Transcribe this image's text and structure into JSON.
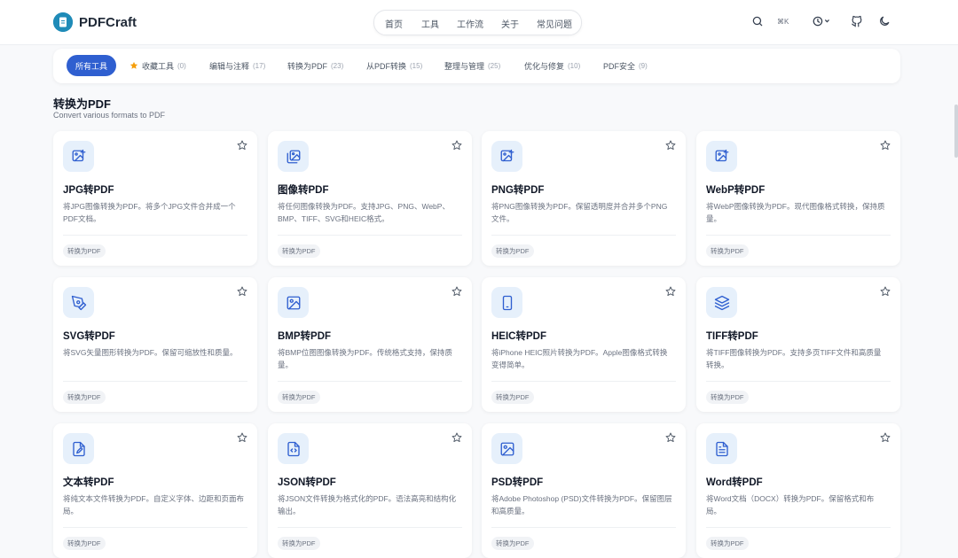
{
  "app": {
    "name": "PDFCraft"
  },
  "nav": [
    "首页",
    "工具",
    "工作流",
    "关于",
    "常见问题"
  ],
  "header": {
    "shortcut": "⌘K"
  },
  "filters": [
    {
      "label": "所有工具",
      "count": ""
    },
    {
      "label": "收藏工具",
      "count": "(0)"
    },
    {
      "label": "编辑与注释",
      "count": "(17)"
    },
    {
      "label": "转换为PDF",
      "count": "(23)"
    },
    {
      "label": "从PDF转换",
      "count": "(15)"
    },
    {
      "label": "整理与管理",
      "count": "(25)"
    },
    {
      "label": "优化与修复",
      "count": "(10)"
    },
    {
      "label": "PDF安全",
      "count": "(9)"
    }
  ],
  "section": {
    "title": "转换为PDF",
    "subtitle": "Convert various formats to PDF"
  },
  "cards": [
    {
      "title": "JPG转PDF",
      "desc": "将JPG图像转换为PDF。将多个JPG文件合并成一个PDF文档。",
      "tag": "转换为PDF",
      "icon": "image-plus-icon"
    },
    {
      "title": "图像转PDF",
      "desc": "将任何图像转换为PDF。支持JPG、PNG、WebP、BMP、TIFF、SVG和HEIC格式。",
      "tag": "转换为PDF",
      "icon": "images-icon"
    },
    {
      "title": "PNG转PDF",
      "desc": "将PNG图像转换为PDF。保留透明度并合并多个PNG文件。",
      "tag": "转换为PDF",
      "icon": "image-plus-icon"
    },
    {
      "title": "WebP转PDF",
      "desc": "将WebP图像转换为PDF。现代图像格式转换，保持质量。",
      "tag": "转换为PDF",
      "icon": "image-plus-icon"
    },
    {
      "title": "SVG转PDF",
      "desc": "将SVG矢量图形转换为PDF。保留可缩放性和质量。",
      "tag": "转换为PDF",
      "icon": "pen-tool-icon"
    },
    {
      "title": "BMP转PDF",
      "desc": "将BMP位图图像转换为PDF。传统格式支持，保持质量。",
      "tag": "转换为PDF",
      "icon": "image-icon"
    },
    {
      "title": "HEIC转PDF",
      "desc": "将iPhone HEIC照片转换为PDF。Apple图像格式转换变得简单。",
      "tag": "转换为PDF",
      "icon": "smartphone-icon"
    },
    {
      "title": "TIFF转PDF",
      "desc": "将TIFF图像转换为PDF。支持多页TIFF文件和高质量转换。",
      "tag": "转换为PDF",
      "icon": "layers-icon"
    },
    {
      "title": "文本转PDF",
      "desc": "将纯文本文件转换为PDF。自定义字体、边距和页面布局。",
      "tag": "转换为PDF",
      "icon": "file-pen-icon"
    },
    {
      "title": "JSON转PDF",
      "desc": "将JSON文件转换为格式化的PDF。语法高亮和结构化输出。",
      "tag": "转换为PDF",
      "icon": "file-code-icon"
    },
    {
      "title": "PSD转PDF",
      "desc": "将Adobe Photoshop (PSD)文件转换为PDF。保留图层和高质量。",
      "tag": "转换为PDF",
      "icon": "image-icon"
    },
    {
      "title": "Word转PDF",
      "desc": "将Word文档（DOCX）转换为PDF。保留格式和布局。",
      "tag": "转换为PDF",
      "icon": "file-text-icon"
    }
  ],
  "colors": {
    "accent": "#2f5fd0",
    "icon_bg": "#e6f0fb",
    "icon_fg": "#2f5fd0",
    "star": "#f59e0b"
  }
}
